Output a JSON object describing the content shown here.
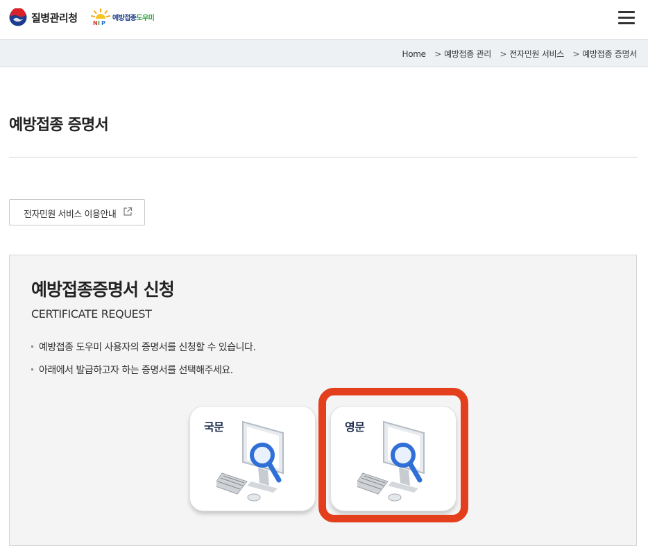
{
  "header": {
    "agency_name": "질병관리청",
    "nip_name_part1": "예방접종",
    "nip_name_part2": "도우미",
    "menu_icon": "hamburger-icon"
  },
  "breadcrumb": {
    "items": [
      "Home",
      "예방접종 관리",
      "전자민원 서비스",
      "예방접종 증명서"
    ],
    "separator": ">"
  },
  "page": {
    "title": "예방접종 증명서"
  },
  "guide_button": {
    "label": "전자민원 서비스 이용안내",
    "icon": "external-link-icon"
  },
  "request_panel": {
    "title": "예방접종증명서 신청",
    "subtitle": "CERTIFICATE REQUEST",
    "bullets": [
      "예방접종 도우미 사용자의 증명서를 신청할 수 있습니다.",
      "아래에서 발급하고자 하는 증명서를 선택해주세요."
    ],
    "options": [
      {
        "label": "국문",
        "icon": "computer-search-icon",
        "highlighted": false
      },
      {
        "label": "영문",
        "icon": "computer-search-icon",
        "highlighted": true
      }
    ]
  },
  "colors": {
    "highlight": "#e43f1c",
    "crumbbar_bg": "#eef1f4",
    "panel_bg": "#f4f4f4",
    "magnifier": "#2f6fd6"
  }
}
